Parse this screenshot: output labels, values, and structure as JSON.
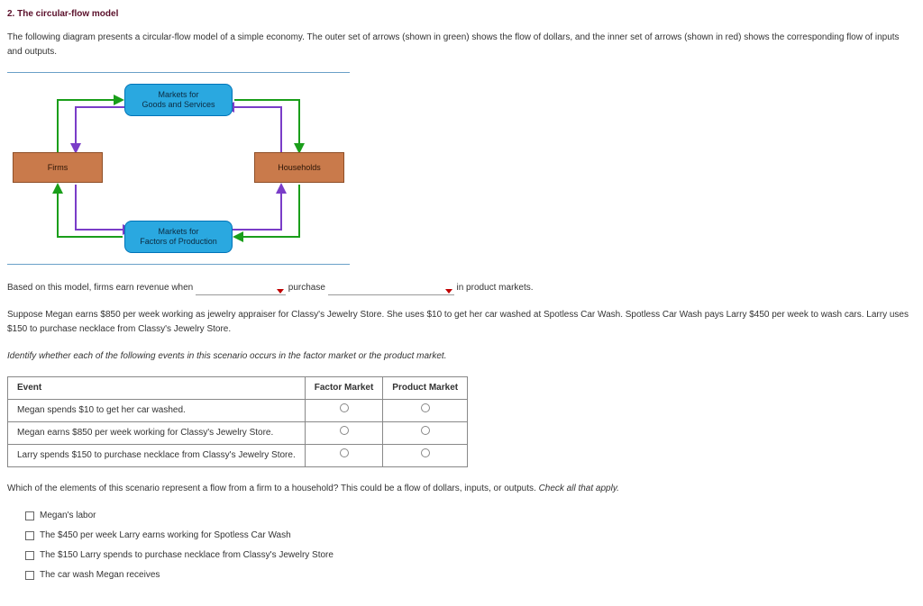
{
  "title": "2. The circular-flow model",
  "intro": "The following diagram presents a circular-flow model of a simple economy. The outer set of arrows (shown in green) shows the flow of dollars, and the inner set of arrows (shown in red) shows the corresponding flow of inputs and outputs.",
  "diagram": {
    "top": "Markets for\nGoods and Services",
    "bottom": "Markets for\nFactors of Production",
    "left": "Firms",
    "right": "Households"
  },
  "fill_sentence": {
    "pre": "Based on this model, firms earn revenue when ",
    "mid": " purchase ",
    "post": " in product markets."
  },
  "scenario": "Suppose Megan earns $850 per week working as jewelry appraiser for Classy's Jewelry Store. She uses $10 to get her car washed at Spotless Car Wash. Spotless Car Wash pays Larry $450 per week to wash cars. Larry uses $150 to purchase necklace from Classy's Jewelry Store.",
  "identify_prompt": "Identify whether each of the following events in this scenario occurs in the factor market or the product market.",
  "table": {
    "headers": [
      "Event",
      "Factor Market",
      "Product Market"
    ],
    "rows": [
      "Megan spends $10 to get her car washed.",
      "Megan earns $850 per week working for Classy's Jewelry Store.",
      "Larry spends $150 to purchase necklace from Classy's Jewelry Store."
    ]
  },
  "flow_q_pre": "Which of the elements of this scenario represent a flow from a firm to a household? This could be a flow of dollars, inputs, or outputs. ",
  "flow_q_ital": "Check all that apply.",
  "checks": [
    "Megan's labor",
    "The $450 per week Larry earns working for Spotless Car Wash",
    "The $150 Larry spends to purchase necklace from Classy's Jewelry Store",
    "The car wash Megan receives"
  ]
}
